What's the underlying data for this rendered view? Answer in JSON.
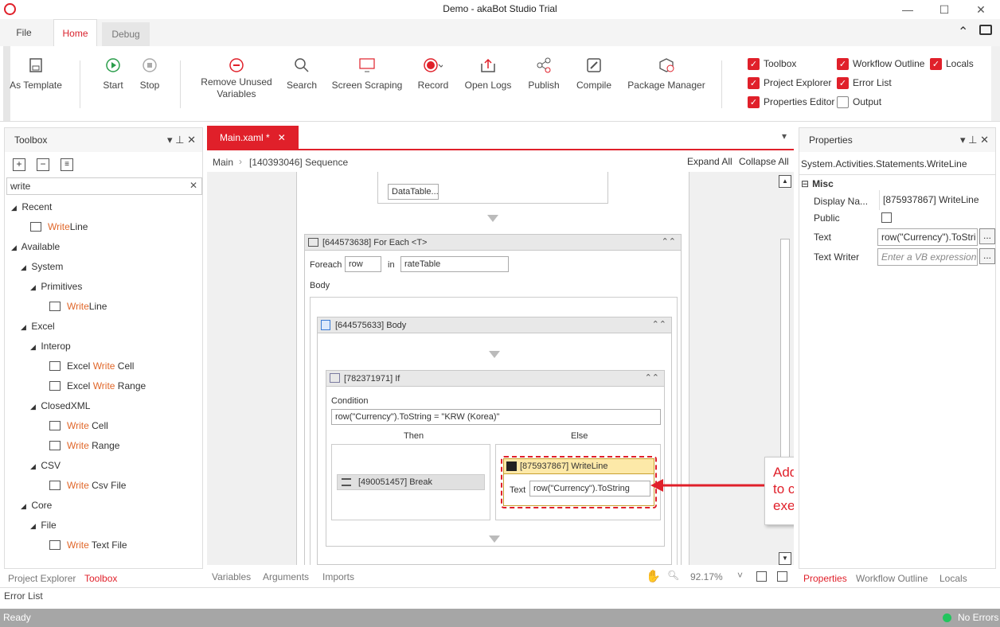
{
  "window": {
    "title": "Demo - akaBot Studio Trial"
  },
  "menu": {
    "file": "File",
    "home": "Home",
    "debug": "Debug"
  },
  "ribbon": {
    "as_template": "As Template",
    "start": "Start",
    "stop": "Stop",
    "remove_unused_1": "Remove Unused",
    "remove_unused_2": "Variables",
    "search": "Search",
    "screen_scraping": "Screen Scraping",
    "record": "Record",
    "open_logs": "Open Logs",
    "publish": "Publish",
    "compile": "Compile",
    "package_manager": "Package Manager",
    "checks": {
      "toolbox": "Toolbox",
      "project_explorer": "Project Explorer",
      "properties_editor": "Properties Editor",
      "workflow_outline": "Workflow Outline",
      "error_list": "Error List",
      "output": "Output",
      "locals": "Locals"
    }
  },
  "toolbox": {
    "title": "Toolbox",
    "search_value": "write",
    "tree": {
      "recent": "Recent",
      "available": "Available",
      "system": "System",
      "primitives": "Primitives",
      "excel": "Excel",
      "interop": "Interop",
      "closedxml": "ClosedXML",
      "csv": "CSV",
      "core": "Core",
      "file": "File"
    },
    "items": {
      "writeline_recent_hl": "Write",
      "writeline_recent_rest": "Line",
      "writeline_hl": "Write",
      "writeline_rest": "Line",
      "excel_write_cell_pre": "Excel ",
      "excel_write_cell_hl": "Write",
      "excel_write_cell_rest": " Cell",
      "excel_write_range_pre": "Excel ",
      "excel_write_range_hl": "Write",
      "excel_write_range_rest": " Range",
      "write_cell_hl": "Write",
      "write_cell_rest": " Cell",
      "write_range_hl": "Write",
      "write_range_rest": " Range",
      "write_csv_hl": "Write",
      "write_csv_rest": " Csv File",
      "write_text_hl": "Write",
      "write_text_rest": " Text File"
    }
  },
  "left_tabs": {
    "project_explorer": "Project Explorer",
    "toolbox": "Toolbox"
  },
  "error_list": "Error List",
  "designer": {
    "doc_tab": "Main.xaml *",
    "breadcrumb_main": "Main",
    "breadcrumb_seq": "[140393046] Sequence",
    "expand_all": "Expand All",
    "collapse_all": "Collapse All",
    "datatable": "DataTable...",
    "foreach_title": "[644573638] For Each <T>",
    "foreach_label": "Foreach",
    "foreach_var": "row",
    "in_label": "in",
    "foreach_collection": "rateTable",
    "body_label": "Body",
    "body_title": "[644575633] Body",
    "if_title": "[782371971] If",
    "condition_label": "Condition",
    "condition_value": "row(\"Currency\").ToString = \"KRW (Korea)\"",
    "then_label": "Then",
    "else_label": "Else",
    "break_title": "[490051457] Break",
    "writeline_title": "[875937867] WriteLine",
    "text_label": "Text",
    "text_value": "row(\"Currency\").ToString",
    "callout_1": "Add this activity",
    "callout_2": "to check the",
    "callout_3": "execution's result"
  },
  "designer_bottom": {
    "variables": "Variables",
    "arguments": "Arguments",
    "imports": "Imports",
    "zoom": "92.17%"
  },
  "properties": {
    "title": "Properties",
    "type": "System.Activities.Statements.WriteLine",
    "section": "Misc",
    "display_name_label": "Display Na...",
    "display_name_value": "[875937867] WriteLine",
    "public_label": "Public",
    "text_label": "Text",
    "text_value": "row(\"Currency\").ToStri",
    "text_writer_label": "Text Writer",
    "text_writer_placeholder": "Enter a VB expression",
    "ellipsis": "..."
  },
  "right_tabs": {
    "properties": "Properties",
    "workflow_outline": "Workflow Outline",
    "locals": "Locals"
  },
  "status": {
    "ready": "Ready",
    "errors": "No Errors"
  },
  "colors": {
    "accent": "#e0202a",
    "status_ok": "#22c55e"
  }
}
